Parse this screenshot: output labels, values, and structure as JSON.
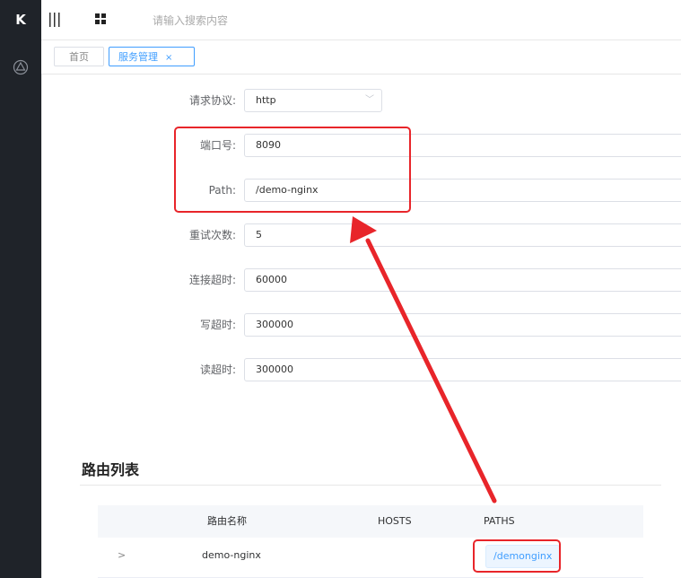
{
  "app": {
    "logo": "K"
  },
  "topbar": {
    "search_placeholder": "请输入搜索内容"
  },
  "tabs": [
    {
      "label": "首页"
    },
    {
      "label": "服务管理",
      "close": "×"
    }
  ],
  "form": {
    "protocol": {
      "label": "请求协议:",
      "value": "http"
    },
    "port": {
      "label": "端口号:",
      "value": "8090"
    },
    "path": {
      "label": "Path:",
      "value": "/demo-nginx"
    },
    "retries": {
      "label": "重试次数:",
      "value": "5"
    },
    "connect_timeout": {
      "label": "连接超时:",
      "value": "60000"
    },
    "write_timeout": {
      "label": "写超时:",
      "value": "300000"
    },
    "read_timeout": {
      "label": "读超时:",
      "value": "300000"
    }
  },
  "routes": {
    "title": "路由列表",
    "columns": [
      "路由名称",
      "HOSTS",
      "PATHS"
    ],
    "rows": [
      {
        "name": "demo-nginx",
        "hosts": "",
        "paths": "/demonginx"
      }
    ]
  },
  "colors": {
    "accent": "#409eff",
    "annotation": "#e8252a",
    "sidebar": "#1f2329"
  }
}
